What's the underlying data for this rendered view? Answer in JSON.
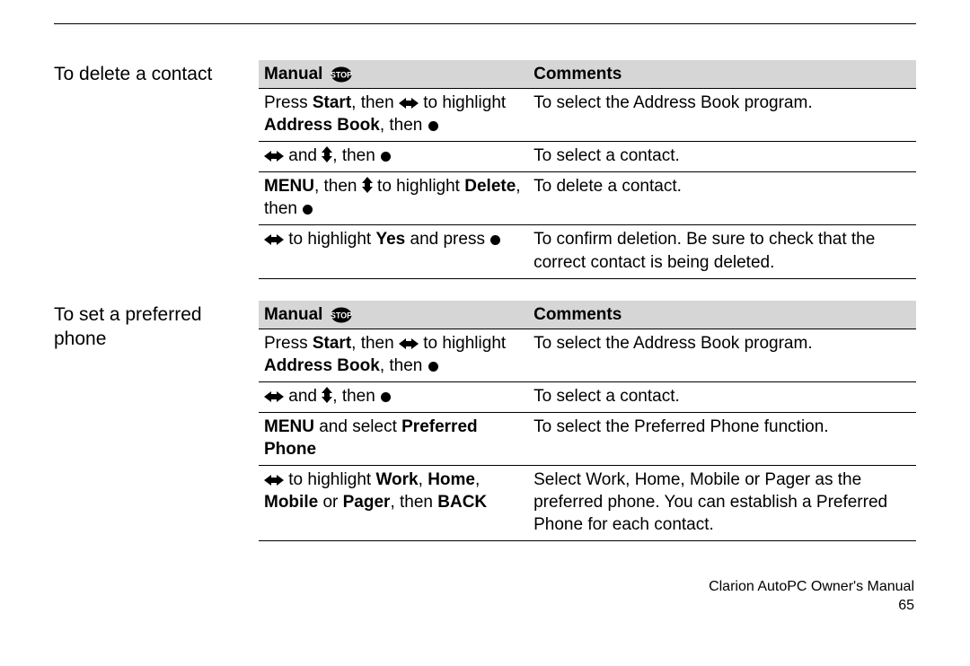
{
  "footer": {
    "title": "Clarion AutoPC Owner's Manual",
    "page": "65"
  },
  "sections": [
    {
      "label": "To delete a contact",
      "headers": {
        "manual": "Manual ",
        "comments": "Comments"
      },
      "rows": [
        {
          "manual": [
            {
              "t": "n",
              "v": "Press "
            },
            {
              "t": "b",
              "v": "Start"
            },
            {
              "t": "n",
              "v": ", then "
            },
            {
              "t": "icon",
              "v": "lr"
            },
            {
              "t": "n",
              "v": " to highlight "
            },
            {
              "t": "b",
              "v": "Address Book"
            },
            {
              "t": "n",
              "v": ", then "
            },
            {
              "t": "icon",
              "v": "dot"
            }
          ],
          "comments": [
            {
              "t": "n",
              "v": "To select the Address Book program."
            }
          ]
        },
        {
          "manual": [
            {
              "t": "icon",
              "v": "lr"
            },
            {
              "t": "n",
              "v": " and "
            },
            {
              "t": "icon",
              "v": "ud"
            },
            {
              "t": "n",
              "v": ", then "
            },
            {
              "t": "icon",
              "v": "dot"
            }
          ],
          "comments": [
            {
              "t": "n",
              "v": "To select a contact."
            }
          ]
        },
        {
          "manual": [
            {
              "t": "b",
              "v": "MENU"
            },
            {
              "t": "n",
              "v": ", then "
            },
            {
              "t": "icon",
              "v": "ud"
            },
            {
              "t": "n",
              "v": " to highlight "
            },
            {
              "t": "b",
              "v": "Delete"
            },
            {
              "t": "n",
              "v": ", then "
            },
            {
              "t": "icon",
              "v": "dot"
            }
          ],
          "comments": [
            {
              "t": "n",
              "v": "To delete a contact."
            }
          ]
        },
        {
          "manual": [
            {
              "t": "icon",
              "v": "lr"
            },
            {
              "t": "n",
              "v": " to highlight "
            },
            {
              "t": "b",
              "v": "Yes"
            },
            {
              "t": "n",
              "v": " and press "
            },
            {
              "t": "icon",
              "v": "dot"
            }
          ],
          "comments": [
            {
              "t": "n",
              "v": "To confirm deletion. Be sure to check that the correct contact is being deleted."
            }
          ]
        }
      ]
    },
    {
      "label": "To set a preferred phone",
      "headers": {
        "manual": "Manual ",
        "comments": "Comments"
      },
      "rows": [
        {
          "manual": [
            {
              "t": "n",
              "v": "Press "
            },
            {
              "t": "b",
              "v": "Start"
            },
            {
              "t": "n",
              "v": ", then "
            },
            {
              "t": "icon",
              "v": "lr"
            },
            {
              "t": "n",
              "v": " to highlight "
            },
            {
              "t": "b",
              "v": "Address Book"
            },
            {
              "t": "n",
              "v": ", then "
            },
            {
              "t": "icon",
              "v": "dot"
            }
          ],
          "comments": [
            {
              "t": "n",
              "v": "To select the Address Book program."
            }
          ]
        },
        {
          "manual": [
            {
              "t": "icon",
              "v": "lr"
            },
            {
              "t": "n",
              "v": " and "
            },
            {
              "t": "icon",
              "v": "ud"
            },
            {
              "t": "n",
              "v": ", then "
            },
            {
              "t": "icon",
              "v": "dot"
            }
          ],
          "comments": [
            {
              "t": "n",
              "v": "To select a contact."
            }
          ]
        },
        {
          "manual": [
            {
              "t": "b",
              "v": "MENU"
            },
            {
              "t": "n",
              "v": " and select "
            },
            {
              "t": "b",
              "v": "Preferred Phone"
            }
          ],
          "comments": [
            {
              "t": "n",
              "v": "To select the Preferred Phone function."
            }
          ]
        },
        {
          "manual": [
            {
              "t": "icon",
              "v": "lr"
            },
            {
              "t": "n",
              "v": " to highlight "
            },
            {
              "t": "b",
              "v": "Work"
            },
            {
              "t": "n",
              "v": ", "
            },
            {
              "t": "b",
              "v": "Home"
            },
            {
              "t": "n",
              "v": ", "
            },
            {
              "t": "b",
              "v": "Mobile"
            },
            {
              "t": "n",
              "v": " or "
            },
            {
              "t": "b",
              "v": "Pager"
            },
            {
              "t": "n",
              "v": ", then "
            },
            {
              "t": "b",
              "v": "BACK"
            }
          ],
          "comments": [
            {
              "t": "n",
              "v": "Select Work, Home, Mobile or Pager as the preferred phone. You can establish a Preferred Phone for each contact."
            }
          ]
        }
      ]
    }
  ]
}
